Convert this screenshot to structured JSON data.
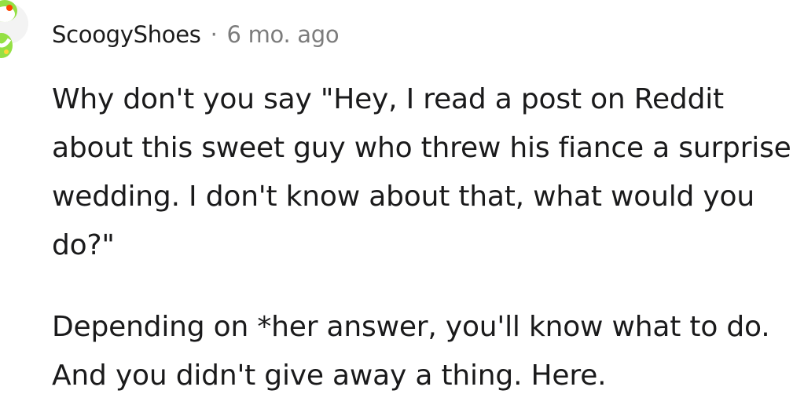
{
  "comment": {
    "author": "ScoogyShoes",
    "separator": "·",
    "timestamp": "6 mo. ago",
    "avatar_icon": "snoo-avatar-icon",
    "paragraphs": [
      "Why don't you say \"Hey, I read a post on Reddit about this sweet guy who threw his fiance a surprise wedding. I don't know about that, what would you do?\"",
      "Depending on *her answer, you'll know what to do. And you didn't give away a thing. Here."
    ]
  },
  "colors": {
    "text": "#1a1a1b",
    "muted": "#7c7c7c",
    "avatar_green": "#94e044",
    "background": "#ffffff"
  }
}
